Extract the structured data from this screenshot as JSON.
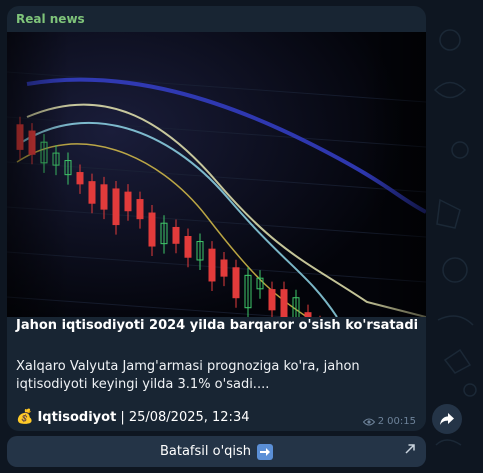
{
  "message": {
    "sender": "Real news",
    "title": "Jahon iqtisodiyoti 2024 yilda barqaror o'sish ko'rsatadi",
    "body": "Xalqaro Valyuta Jamg'armasi prognoziga ko'ra, jahon iqtisodiyoti keyingi yilda 3.1% o'sadi....",
    "source_name": "Iqtisodiyot",
    "source_rest": " | 25/08/2025, 12:34",
    "views": "2",
    "time": "00:15",
    "image_icon": "candlestick-chart-photo"
  },
  "button": {
    "label": "Batafsil o'qish",
    "arrow_icon": "right-arrow-emoji",
    "external_icon": "external-link-icon"
  },
  "share": {
    "icon": "share-icon"
  },
  "colors": {
    "chat_bg": "#0e1621",
    "bubble": "#182533",
    "sender": "#7fc47a",
    "button_bg": "#243447",
    "candle_red": "#e23b3b",
    "candle_green": "#3fc86a"
  }
}
